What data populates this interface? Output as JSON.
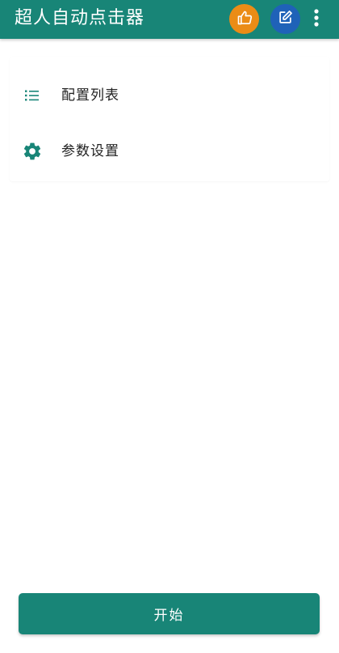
{
  "appbar": {
    "title": "超人自动点击器",
    "background_color": "#188577",
    "actions": [
      {
        "icon": "thumbs-up-icon",
        "color": "#EB8C16"
      },
      {
        "icon": "edit-icon",
        "color": "#1F62B8"
      },
      {
        "icon": "more-vertical-icon",
        "color": "#FFFFFF"
      }
    ]
  },
  "menu": {
    "items": [
      {
        "label": "配置列表",
        "icon": "list-icon",
        "icon_color": "#188577"
      },
      {
        "label": "参数设置",
        "icon": "gear-icon",
        "icon_color": "#188577"
      }
    ]
  },
  "footer": {
    "start_label": "开始",
    "button_color": "#188577"
  }
}
